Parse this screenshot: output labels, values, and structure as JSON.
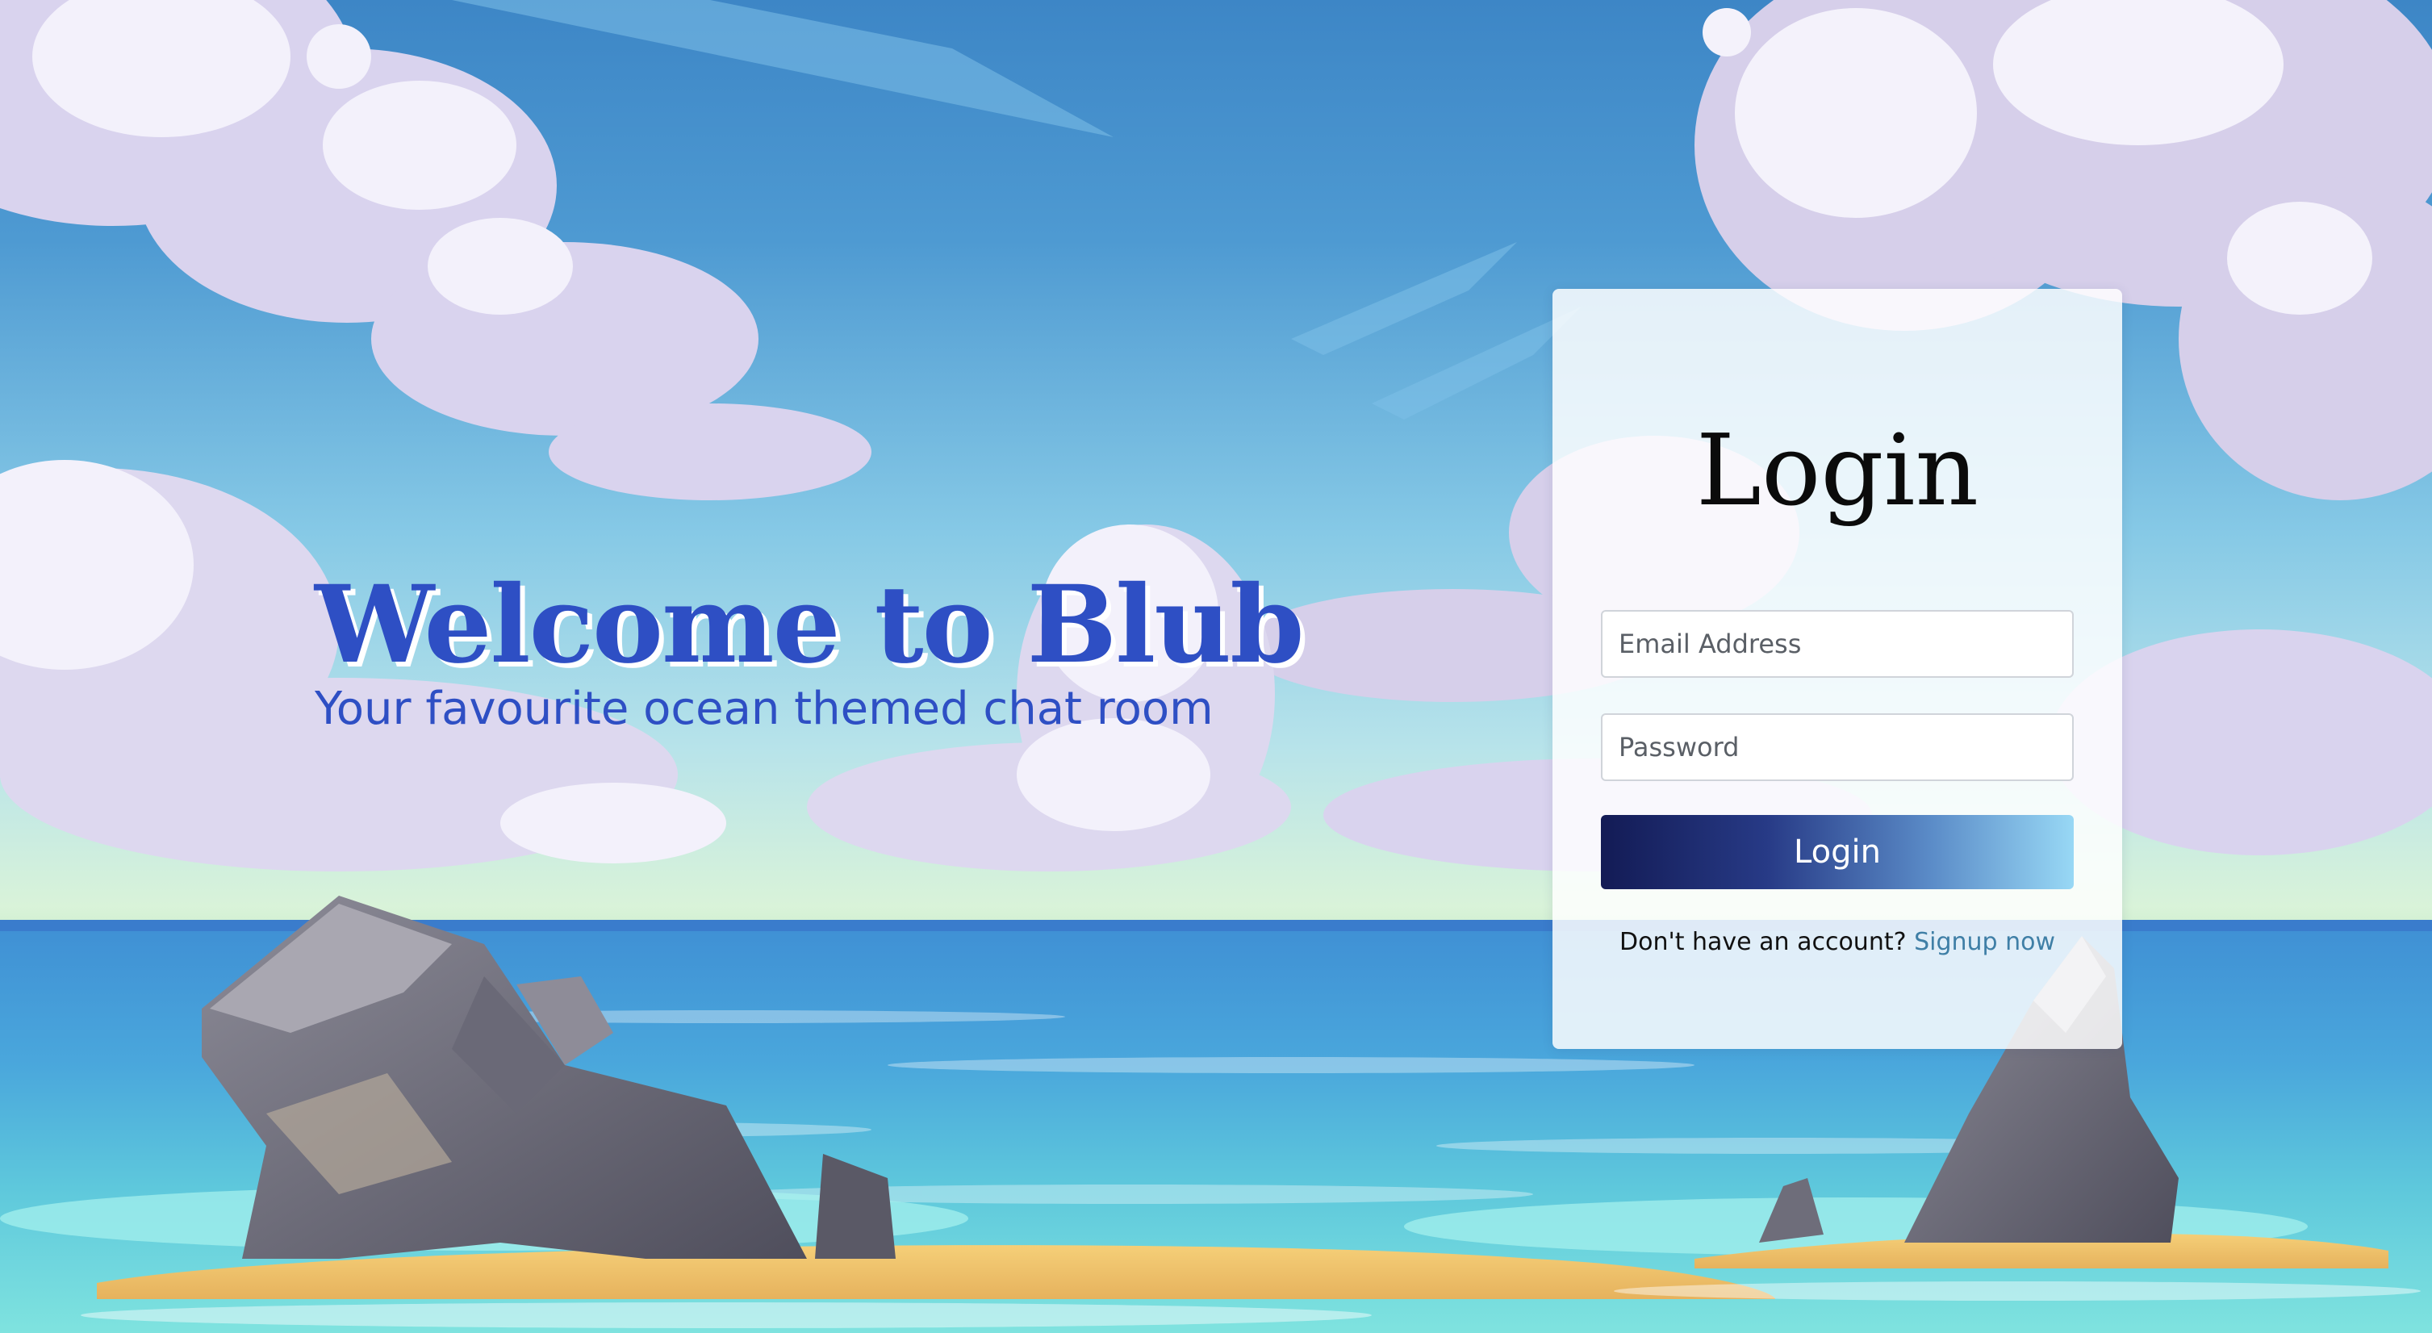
{
  "hero": {
    "title": "Welcome to Blub",
    "subtitle": "Your favourite ocean themed chat room"
  },
  "login": {
    "title": "Login",
    "email_placeholder": "Email Address",
    "password_placeholder": "Password",
    "button_label": "Login",
    "signup_prompt": "Don't have an account?",
    "signup_link": "Signup now"
  },
  "colors": {
    "brand_blue": "#2e4fc4",
    "button_gradient_start": "#131b55",
    "button_gradient_end": "#98d8f5",
    "link": "#3f7fa6"
  }
}
